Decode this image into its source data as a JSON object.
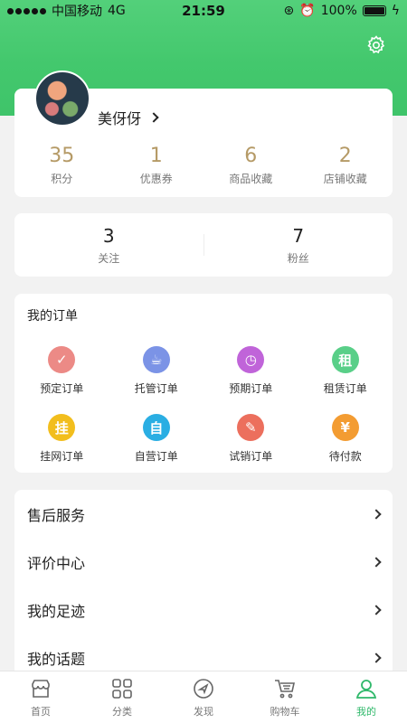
{
  "status_bar": {
    "carrier": "中国移动",
    "network": "4G",
    "time": "21:59",
    "battery": "100%"
  },
  "profile": {
    "username": "美伢伢",
    "stats": [
      {
        "value": "35",
        "label": "积分"
      },
      {
        "value": "1",
        "label": "优惠券"
      },
      {
        "value": "6",
        "label": "商品收藏"
      },
      {
        "value": "2",
        "label": "店铺收藏"
      }
    ]
  },
  "social": {
    "follow": {
      "value": "3",
      "label": "关注"
    },
    "fans": {
      "value": "7",
      "label": "粉丝"
    }
  },
  "orders": {
    "title": "我的订单",
    "items": [
      {
        "label": "预定订单",
        "icon": "reserve-icon",
        "color": "#ec8a86",
        "glyph": "✓"
      },
      {
        "label": "托管订单",
        "icon": "custody-icon",
        "color": "#7b93e6",
        "glyph": "☕"
      },
      {
        "label": "预期订单",
        "icon": "clock-icon",
        "color": "#c064d9",
        "glyph": "◷"
      },
      {
        "label": "租赁订单",
        "icon": "rent-icon",
        "color": "#59cf88",
        "glyph": "租"
      },
      {
        "label": "挂网订单",
        "icon": "listing-icon",
        "color": "#f2be1d",
        "glyph": "挂"
      },
      {
        "label": "自营订单",
        "icon": "self-run-icon",
        "color": "#2aaee3",
        "glyph": "自"
      },
      {
        "label": "试销订单",
        "icon": "trial-sale-icon",
        "color": "#ec6f5d",
        "glyph": "✎"
      },
      {
        "label": "待付款",
        "icon": "pending-payment-icon",
        "color": "#f39c32",
        "glyph": "¥"
      }
    ]
  },
  "menu": [
    {
      "label": "售后服务"
    },
    {
      "label": "评价中心"
    },
    {
      "label": "我的足迹"
    },
    {
      "label": "我的话题"
    }
  ],
  "tabbar": [
    {
      "label": "首页",
      "icon": "store-icon"
    },
    {
      "label": "分类",
      "icon": "grid-icon"
    },
    {
      "label": "发现",
      "icon": "compass-icon"
    },
    {
      "label": "购物车",
      "icon": "cart-icon"
    },
    {
      "label": "我的",
      "icon": "user-icon",
      "active": true
    }
  ],
  "colors": {
    "brand_green": "#43c86d",
    "accent_gold": "#b59a66",
    "active_tab": "#2fb86a"
  }
}
